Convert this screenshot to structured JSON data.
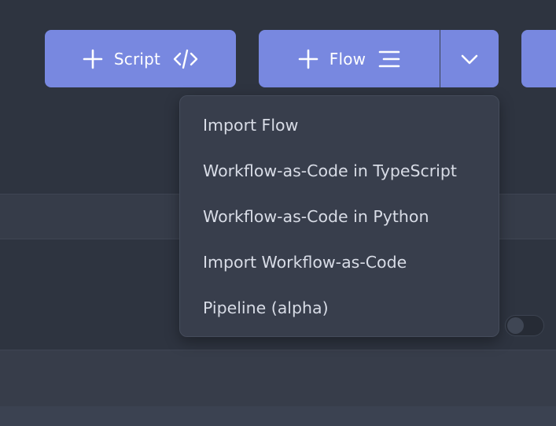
{
  "toolbar": {
    "script_button": {
      "label": "Script",
      "icon_left": "plus-icon",
      "icon_right": "code-icon"
    },
    "flow_button": {
      "label": "Flow",
      "icon_left": "plus-icon",
      "icon_right": "flow-lines-icon",
      "dropdown_icon": "chevron-down-icon"
    }
  },
  "flow_menu": {
    "items": [
      {
        "label": "Import Flow"
      },
      {
        "label": "Workflow-as-Code in TypeScript"
      },
      {
        "label": "Workflow-as-Code in Python"
      },
      {
        "label": "Import Workflow-as-Code"
      },
      {
        "label": "Pipeline (alpha)"
      }
    ]
  },
  "colors": {
    "accent": "#7888e0",
    "background": "#2e3440",
    "menu_bg": "#383e4c",
    "menu_text": "#d8dce6"
  },
  "toggle": {
    "state": "off"
  }
}
